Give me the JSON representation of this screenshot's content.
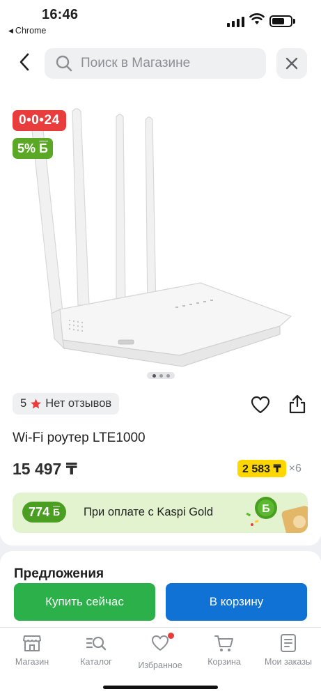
{
  "status_bar": {
    "time": "16:46",
    "back_app": "Chrome"
  },
  "search": {
    "placeholder": "Поиск в Магазине"
  },
  "product": {
    "timer_badge": "0•0•24",
    "bonus_badge": "5%",
    "bonus_symbol": "Б",
    "image_pages": 3,
    "active_page": 1,
    "rating": "5",
    "reviews": "Нет отзывов",
    "title": "Wi-Fi роутер LTE1000",
    "price": "15 497 ₸",
    "installment_price": "2 583 ₸",
    "installment_multiplier": "×6"
  },
  "kaspi_gold": {
    "bonus": "774",
    "bonus_symbol": "Б",
    "text": "При оплате с Kaspi Gold"
  },
  "offers": {
    "title": "Предложения"
  },
  "actions": {
    "buy_now": "Купить сейчас",
    "add_to_cart": "В корзину"
  },
  "nav": {
    "items": [
      {
        "label": "Магазин",
        "icon": "store-icon"
      },
      {
        "label": "Каталог",
        "icon": "catalog-search-icon"
      },
      {
        "label": "Избранное",
        "icon": "heart-icon",
        "has_dot": true
      },
      {
        "label": "Корзина",
        "icon": "cart-icon"
      },
      {
        "label": "Мои заказы",
        "icon": "orders-icon"
      }
    ]
  },
  "colors": {
    "timer_red": "#e93d3d",
    "bonus_green": "#5aa826",
    "buy_green": "#2cb04a",
    "cart_blue": "#0f72d4",
    "installment_yellow": "#ffd700",
    "gold_banner_bg": "#e3f3cf"
  }
}
